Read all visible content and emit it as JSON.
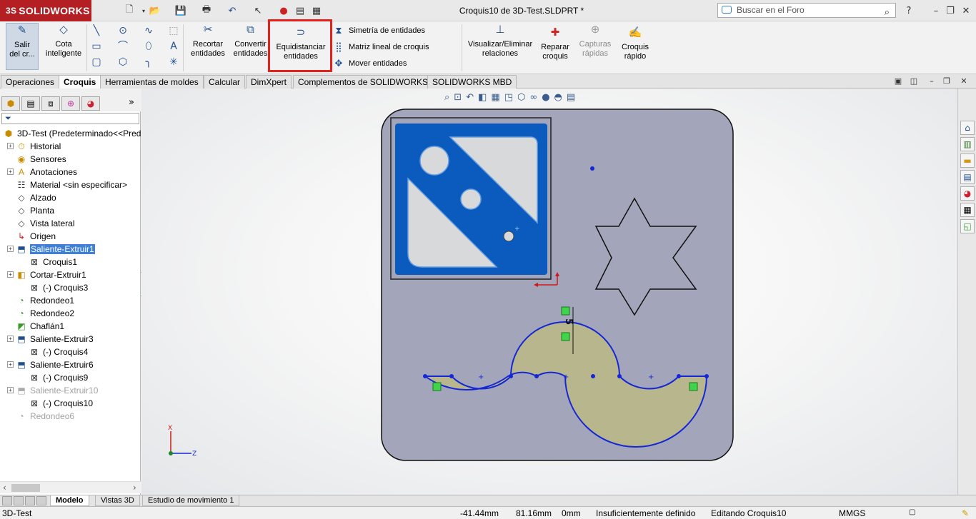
{
  "app": {
    "brand": "SOLIDWORKS",
    "window_title": "Croquis10 de 3D-Test.SLDPRT *",
    "search_placeholder": "Buscar en el Foro"
  },
  "ribbon": {
    "buttons": [
      {
        "id": "salir",
        "label": "Salir\ndel cr..."
      },
      {
        "id": "cota",
        "label": "Cota\ninteligente"
      },
      {
        "id": "recortar",
        "label": "Recortar\nentidades"
      },
      {
        "id": "convertir",
        "label": "Convertir\nentidades"
      },
      {
        "id": "equidistanciar",
        "label": "Equidistanciar\nentidades"
      },
      {
        "id": "visualizar",
        "label": "Visualizar/Eliminar\nrelaciones"
      },
      {
        "id": "reparar",
        "label": "Reparar\ncroquis"
      },
      {
        "id": "capturas",
        "label": "Capturas\nrápidas"
      },
      {
        "id": "croquis_rapido",
        "label": "Croquis\nrápido"
      }
    ],
    "small": {
      "simetria": "Simetría de entidades",
      "matriz": "Matriz lineal de croquis",
      "mover": "Mover entidades"
    }
  },
  "tabs": [
    "Operaciones",
    "Croquis",
    "Herramientas de moldes",
    "Calcular",
    "DimXpert",
    "Complementos de SOLIDWORKS",
    "SOLIDWORKS MBD"
  ],
  "active_tab": "Croquis",
  "tree": {
    "root": "3D-Test  (Predeterminado<<Pred",
    "items": [
      {
        "label": "Historial",
        "icon": "history-icon"
      },
      {
        "label": "Sensores",
        "icon": "sensor-icon"
      },
      {
        "label": "Anotaciones",
        "icon": "annotation-icon"
      },
      {
        "label": "Material <sin especificar>",
        "icon": "material-icon"
      },
      {
        "label": "Alzado",
        "icon": "plane-icon"
      },
      {
        "label": "Planta",
        "icon": "plane-icon"
      },
      {
        "label": "Vista lateral",
        "icon": "plane-icon"
      },
      {
        "label": "Origen",
        "icon": "origin-icon"
      },
      {
        "label": "Saliente-Extruir1",
        "icon": "extrude-icon"
      },
      {
        "label": "Croquis1",
        "icon": "sketch-icon"
      },
      {
        "label": "Cortar-Extruir1",
        "icon": "cut-icon"
      },
      {
        "label": "(-) Croquis3",
        "icon": "sketch-icon"
      },
      {
        "label": "Redondeo1",
        "icon": "fillet-icon"
      },
      {
        "label": "Redondeo2",
        "icon": "fillet-icon"
      },
      {
        "label": "Chaflán1",
        "icon": "chamfer-icon"
      },
      {
        "label": "Saliente-Extruir3",
        "icon": "extrude-icon"
      },
      {
        "label": "(-) Croquis4",
        "icon": "sketch-icon"
      },
      {
        "label": "Saliente-Extruir6",
        "icon": "extrude-icon"
      },
      {
        "label": "(-) Croquis9",
        "icon": "sketch-icon"
      },
      {
        "label": "Saliente-Extruir10",
        "icon": "extrude-icon"
      },
      {
        "label": "(-) Croquis10",
        "icon": "sketch-icon"
      },
      {
        "label": "Redondeo6",
        "icon": "fillet-icon"
      }
    ]
  },
  "bottom_tabs": [
    "Modelo",
    "Vistas 3D",
    "Estudio de movimiento 1"
  ],
  "status": {
    "part": "3D-Test",
    "x": "-41.44mm",
    "y": "81.16mm",
    "z": "0mm",
    "state": "Insuficientemente definido",
    "editing": "Editando Croquis10",
    "units": "MMGS"
  },
  "canvas": {
    "axis_x": "X",
    "axis_z": "Z",
    "colors": {
      "plate": "#a3a6ba",
      "logo_blue": "#0a5bbd",
      "sketch_blue": "#1526d6",
      "fill": "#b8b68d",
      "highlight": "#e3201b"
    }
  }
}
